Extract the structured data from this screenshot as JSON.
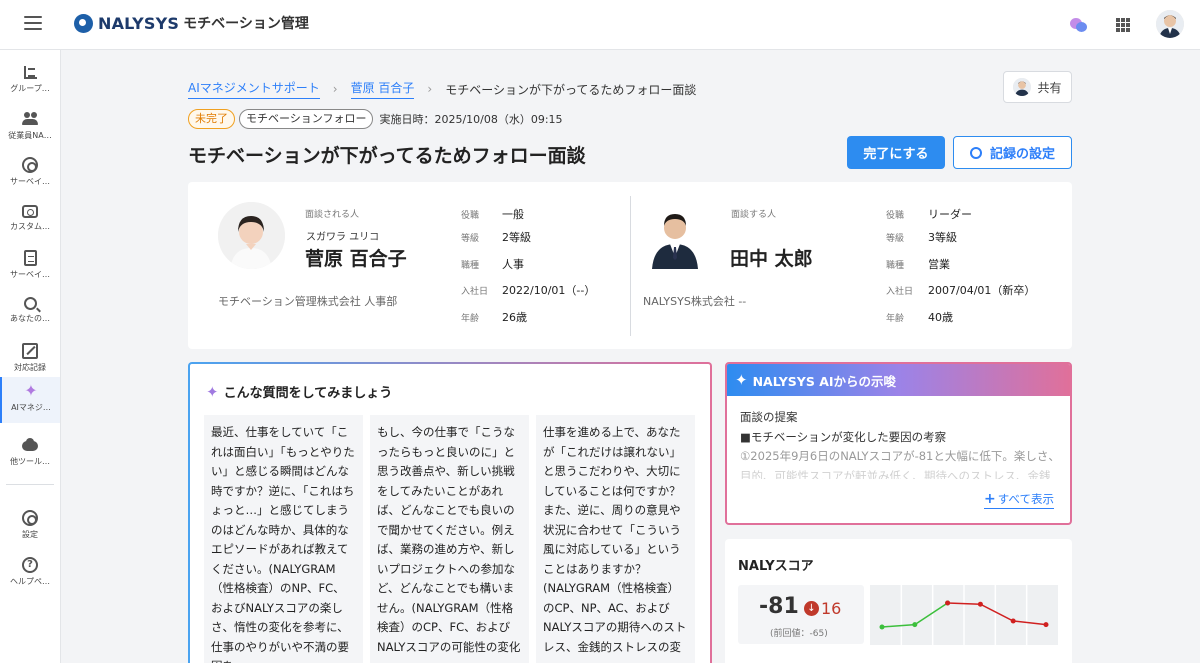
{
  "app": {
    "brand": "NALYSYS",
    "module": "モチベーション管理"
  },
  "sidebar": {
    "items": [
      {
        "label": "グループ…",
        "icon": "chart-list-icon"
      },
      {
        "label": "従業員NA…",
        "icon": "users-icon"
      },
      {
        "label": "サーベイ…",
        "icon": "gear-icon"
      },
      {
        "label": "カスタム…",
        "icon": "camera-icon"
      },
      {
        "label": "サーベイ…",
        "icon": "document-icon"
      },
      {
        "label": "あなたの…",
        "icon": "search-chart-icon"
      },
      {
        "label": "対応記録",
        "icon": "edit-icon"
      },
      {
        "label": "AIマネジ…",
        "icon": "sparkle-icon"
      },
      {
        "label": "他ツール…",
        "icon": "cloud-upload-icon"
      },
      {
        "label": "設定",
        "icon": "gear-icon"
      },
      {
        "label": "ヘルプペ…",
        "icon": "help-icon"
      }
    ]
  },
  "breadcrumb": {
    "items": [
      "AIマネジメントサポート",
      "菅原 百合子"
    ],
    "current": "モチベーションが下がってるためフォロー面談",
    "sep": "›"
  },
  "share": {
    "label": "共有"
  },
  "tags": {
    "status": "未完了",
    "category": "モチベーションフォロー",
    "date": "実施日時：2025/10/08（水）09:15"
  },
  "title": "モチベーションが下がってるためフォロー面談",
  "actions": {
    "complete": "完了にする",
    "settings": "記録の設定"
  },
  "interviewee": {
    "role_label": "面談される人",
    "kana": "スガワラ ユリコ",
    "name": "菅原 百合子",
    "org": "モチベーション管理株式会社 人事部",
    "fields": [
      {
        "key": "役職",
        "value": "一般"
      },
      {
        "key": "等級",
        "value": "2等級"
      },
      {
        "key": "職種",
        "value": "人事"
      },
      {
        "key": "入社日",
        "value": "2022/10/01（--）"
      },
      {
        "key": "年齢",
        "value": "26歳"
      }
    ]
  },
  "interviewer": {
    "role_label": "面談する人",
    "name": "田中 太郎",
    "org": "NALYSYS株式会社 --",
    "fields": [
      {
        "key": "役職",
        "value": "リーダー"
      },
      {
        "key": "等級",
        "value": "3等級"
      },
      {
        "key": "職種",
        "value": "営業"
      },
      {
        "key": "入社日",
        "value": "2007/04/01（新卒）"
      },
      {
        "key": "年齢",
        "value": "40歳"
      }
    ]
  },
  "questions": {
    "title": "こんな質問をしてみましょう",
    "items": [
      "最近、仕事をしていて「これは面白い」「もっとやりたい」と感じる瞬間はどんな時ですか？逆に、「これはちょっと…」と感じてしまうのはどんな時か、具体的なエピソードがあれば教えてください。(NALYGRAM（性格検査）のNP、FC、およびNALYスコアの楽しさ、惰性の変化を参考に、仕事のやりがいや不満の要因を",
      "もし、今の仕事で「こうなったらもっと良いのに」と思う改善点や、新しい挑戦をしてみたいことがあれば、どんなことでも良いので聞かせてください。例えば、業務の進め方や、新しいプロジェクトへの参加など、どんなことでも構いません。(NALYGRAM（性格検査）のCP、FC、およびNALYスコアの可能性の変化",
      "仕事を進める上で、あなたが「これだけは譲れない」と思うこだわりや、大切にしていることは何ですか？また、逆に、周りの意見や状況に合わせて「こういう風に対応している」ということはありますか？(NALYGRAM（性格検査）のCP、NP、AC、およびNALYスコアの期待へのストレス、金銭的ストレスの変"
    ]
  },
  "ai": {
    "title": "NALYSYS AIからの示唆",
    "line1": "面談の提案",
    "line2": "■モチベーションが変化した要因の考察",
    "line3": "①2025年9月6日のNALYスコアが-81と大幅に低下。楽しさ、",
    "line4": "目的、可能性スコアが軒並み低く、期待へのストレス、金銭",
    "more": "すべて表示"
  },
  "score": {
    "title": "NALYスコア",
    "value": "-81",
    "diff": "16",
    "prev": "(前回値：-65)"
  },
  "chart_data": {
    "type": "line",
    "series": [
      {
        "color": "#3cbf3c",
        "values": [
          -70,
          -68,
          -50,
          null,
          null,
          null
        ]
      },
      {
        "color": "#d02020",
        "values": [
          null,
          null,
          -50,
          -51,
          -65,
          -68
        ]
      }
    ]
  }
}
